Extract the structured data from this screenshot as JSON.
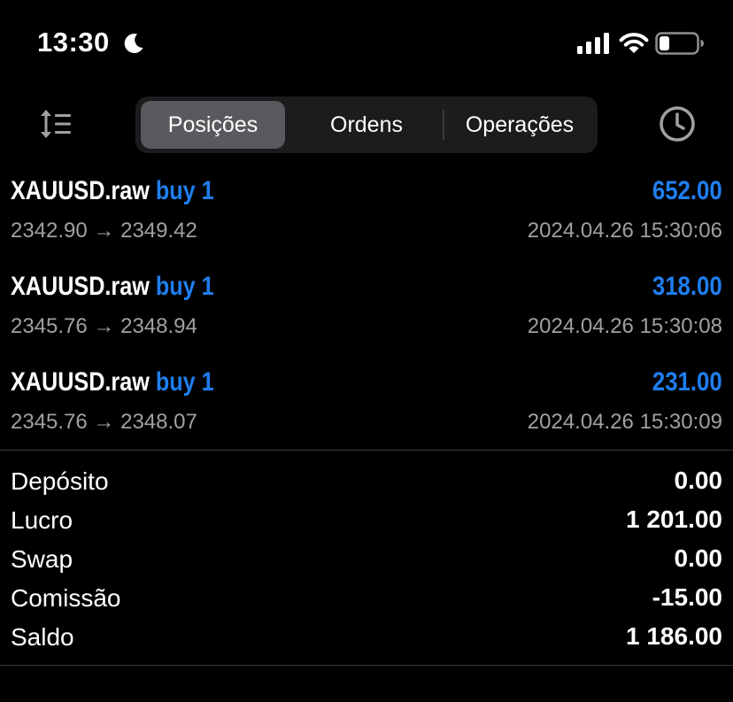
{
  "status_bar": {
    "time": "13:30",
    "icons": [
      "moon-icon",
      "cellular-signal-icon",
      "wifi-icon",
      "battery-icon"
    ]
  },
  "toolbar": {
    "sort_icon": "sort-icon",
    "history_icon": "clock-icon",
    "tabs": [
      {
        "label": "Posições",
        "active": true
      },
      {
        "label": "Ordens",
        "active": false
      },
      {
        "label": "Operações",
        "active": false
      }
    ]
  },
  "positions": [
    {
      "symbol": "XAUUSD.raw",
      "side": "buy 1",
      "profit": "652.00",
      "prices": "2342.90 → 2349.42",
      "time": "2024.04.26 15:30:06"
    },
    {
      "symbol": "XAUUSD.raw",
      "side": "buy 1",
      "profit": "318.00",
      "prices": "2345.76 → 2348.94",
      "time": "2024.04.26 15:30:08"
    },
    {
      "symbol": "XAUUSD.raw",
      "side": "buy 1",
      "profit": "231.00",
      "prices": "2345.76 → 2348.07",
      "time": "2024.04.26 15:30:09"
    }
  ],
  "summary": [
    {
      "label": "Depósito",
      "value": "0.00"
    },
    {
      "label": "Lucro",
      "value": "1 201.00"
    },
    {
      "label": "Swap",
      "value": "0.00"
    },
    {
      "label": "Comissão",
      "value": "-15.00"
    },
    {
      "label": "Saldo",
      "value": "1 186.00"
    }
  ],
  "colors": {
    "background": "#000000",
    "accent_blue": "#1f7ef0",
    "secondary_text": "#a0a0a5",
    "segment_bg": "#1c1c1e",
    "segment_active": "#5a5a5e"
  }
}
